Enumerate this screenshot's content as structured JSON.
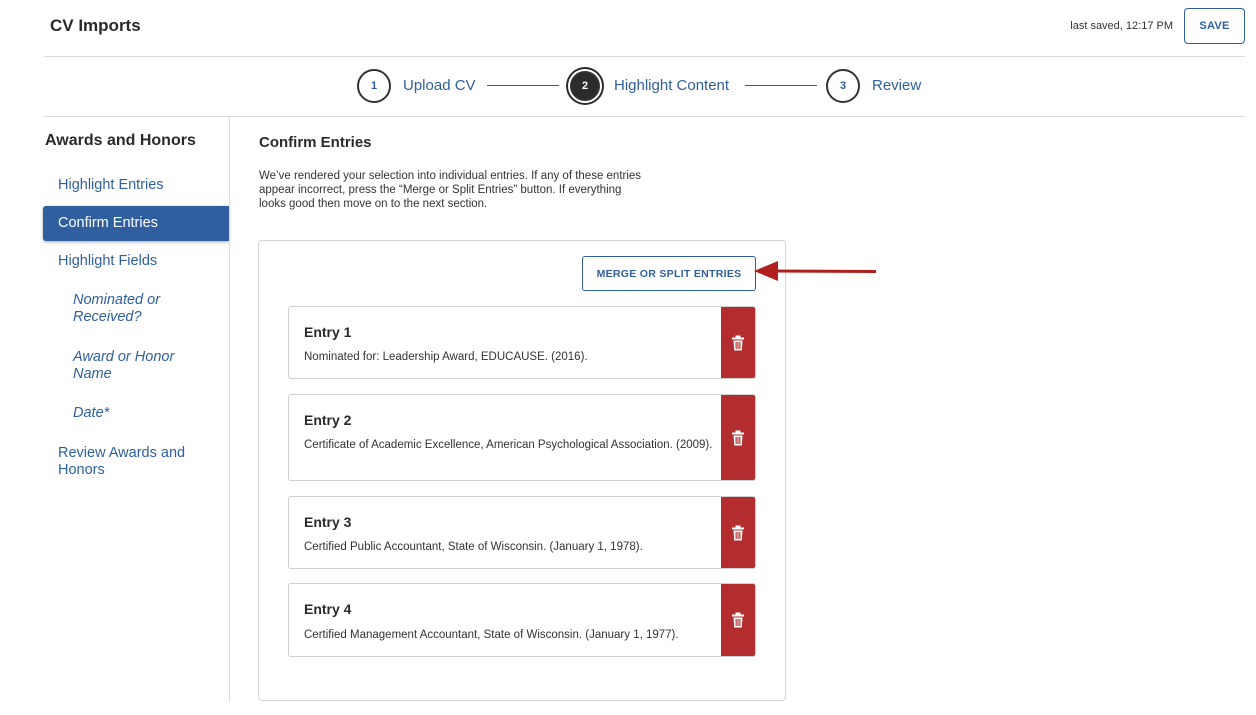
{
  "header": {
    "title": "CV Imports",
    "last_saved": "last saved, 12:17 PM",
    "save_label": "SAVE"
  },
  "stepper": {
    "steps": [
      {
        "number": "1",
        "label": "Upload CV"
      },
      {
        "number": "2",
        "label": "Highlight Content"
      },
      {
        "number": "3",
        "label": "Review"
      }
    ],
    "active_step": 2
  },
  "sidebar": {
    "title": "Awards and Honors",
    "items": [
      {
        "label": "Highlight Entries"
      },
      {
        "label": "Confirm Entries"
      },
      {
        "label": "Highlight Fields"
      },
      {
        "label": "Nominated or Received?"
      },
      {
        "label": "Award or Honor Name"
      },
      {
        "label": "Date*"
      },
      {
        "label": "Review Awards and Honors"
      }
    ],
    "active_item": "Confirm Entries"
  },
  "main": {
    "title": "Confirm Entries",
    "description": "We’ve rendered your selection into individual entries. If any of these entries appear incorrect, press the “Merge or Split Entries” button. If everything looks good then move on to the next section.",
    "merge_label": "MERGE OR SPLIT ENTRIES",
    "entries": [
      {
        "title": "Entry 1",
        "text": "Nominated for: Leadership Award, EDUCAUSE. (2016)."
      },
      {
        "title": "Entry 2",
        "text": "Certificate of Academic Excellence, American Psychological Association. (2009)."
      },
      {
        "title": "Entry 3",
        "text": "Certified Public Accountant, State of Wisconsin. (January 1, 1978)."
      },
      {
        "title": "Entry 4",
        "text": "Certified Management Accountant, State of Wisconsin. (January 1, 1977)."
      }
    ]
  },
  "colors": {
    "accent": "#2f5f9e",
    "delete": "#b32d2e",
    "arrow": "#b01e1e"
  },
  "icons": {
    "delete": "trash-icon",
    "annotation": "arrow-left-annotation"
  }
}
